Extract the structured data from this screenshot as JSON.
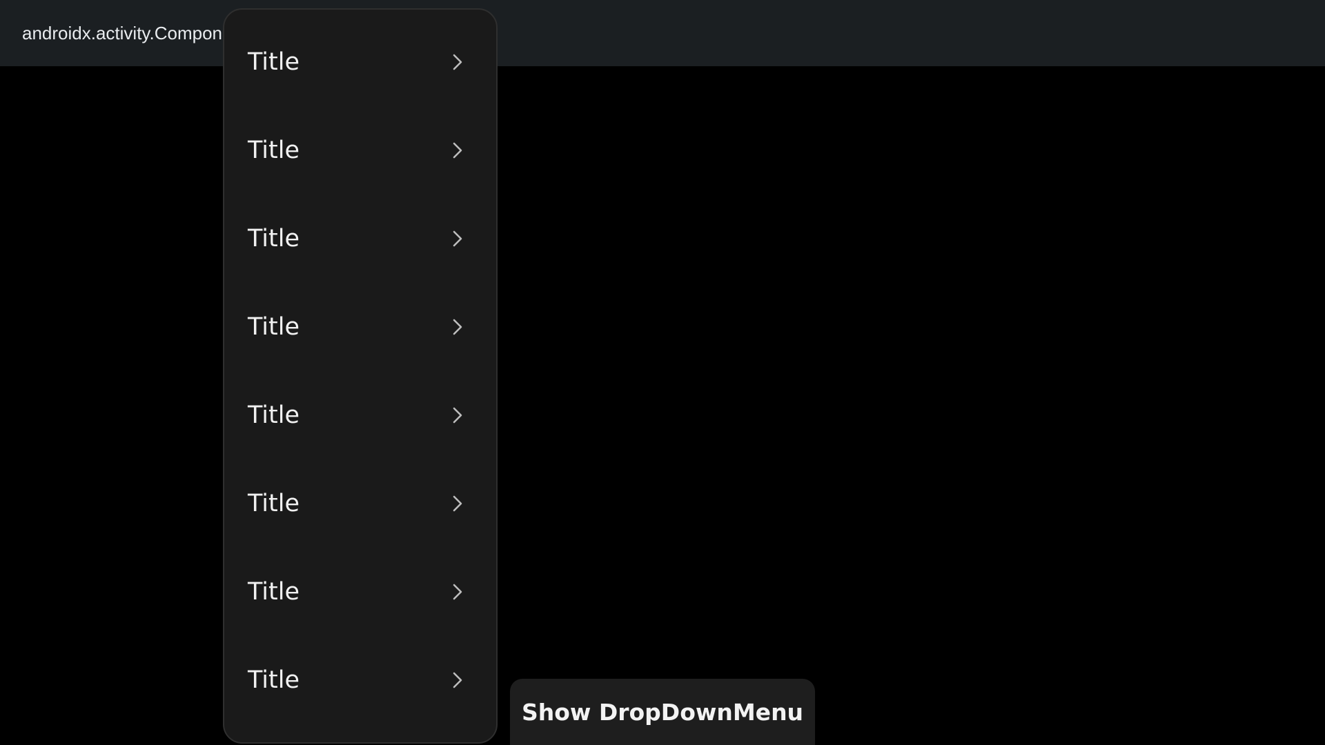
{
  "window": {
    "title": "androidx.activity.ComponentActivity"
  },
  "dropdown_menu": {
    "items": [
      {
        "label": "Title",
        "icon": "chevron-right-icon"
      },
      {
        "label": "Title",
        "icon": "chevron-right-icon"
      },
      {
        "label": "Title",
        "icon": "chevron-right-icon"
      },
      {
        "label": "Title",
        "icon": "chevron-right-icon"
      },
      {
        "label": "Title",
        "icon": "chevron-right-icon"
      },
      {
        "label": "Title",
        "icon": "chevron-right-icon"
      },
      {
        "label": "Title",
        "icon": "chevron-right-icon"
      },
      {
        "label": "Title",
        "icon": "chevron-right-icon"
      }
    ]
  },
  "main": {
    "show_button_label": "Show DropDownMenu"
  },
  "colors": {
    "background": "#000000",
    "title_bar": "#1b1f22",
    "menu_surface": "#1a1a1a",
    "button_surface": "#1e1e1e",
    "text": "#f1f1f1",
    "chevron": "#bdbdbd"
  }
}
